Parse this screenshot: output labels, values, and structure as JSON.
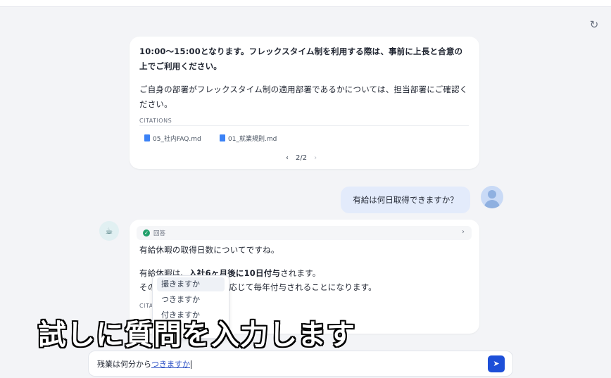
{
  "header": {
    "refresh_icon": "refresh-icon"
  },
  "messages": {
    "previous_answer": {
      "paragraph1": "10:00〜15:00となります。フレックスタイム制を利用する際は、事前に上長と合意の上でご利用ください。",
      "paragraph2": "ご自身の部署がフレックスタイム制の適用部署であるかについては、担当部署にご確認ください。",
      "citations_label": "CITATIONS",
      "citations": [
        "05_社内FAQ.md",
        "01_就業規則.md"
      ],
      "pager": {
        "prev": "‹",
        "text": "2/2",
        "next": "›"
      }
    },
    "user_question": "有給は何日取得できますか？",
    "bot_answer": {
      "header_label": "回答",
      "line1": "有給休暇の取得日数についてですね。",
      "line2_prefix": "有給休暇は、",
      "line2_bold": "入社6ヶ月後に10日付与",
      "line2_suffix": "されます。",
      "line3_start": "その",
      "line3_rest": "応じて毎年付与されることになります。",
      "citations_label": "CITA"
    }
  },
  "ime_dropdown": {
    "options": [
      "撮きますか",
      "つきますか",
      "付きますか"
    ]
  },
  "caption": "試しに質問を入力します",
  "input": {
    "typed": "残業は何分から",
    "composing": "つきますか"
  },
  "colors": {
    "accent": "#1d4fd8",
    "user_bubble": "#e3ebfb",
    "status_green": "#22a06b"
  }
}
